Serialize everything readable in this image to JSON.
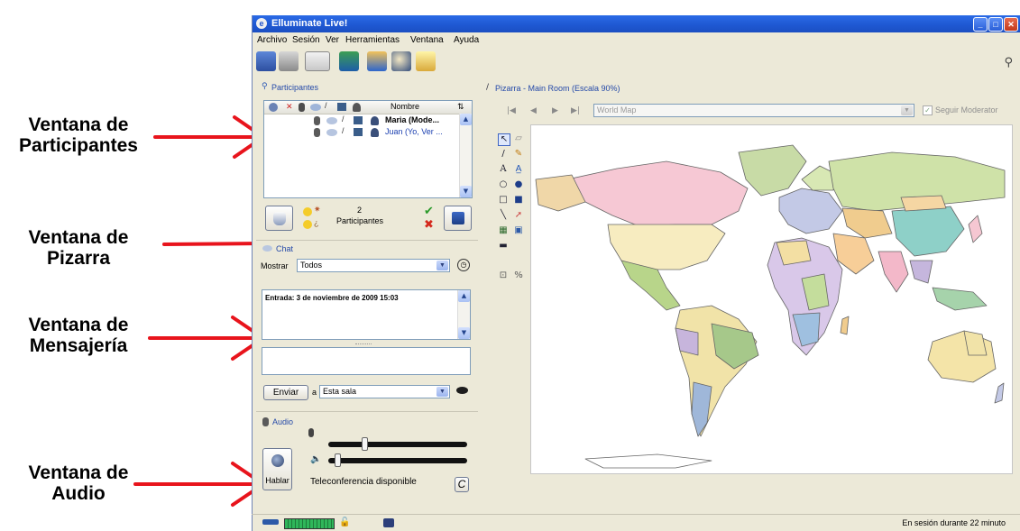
{
  "annotations": {
    "participants": "Ventana de Participantes",
    "whiteboard": "Ventana de Pizarra",
    "chat": "Ventana de Mensajería",
    "audio": "Ventana de Audio"
  },
  "window": {
    "title": "Elluminate Live!",
    "menu": [
      "Archivo",
      "Sesión",
      "Ver",
      "Herramientas",
      "Ventana",
      "Ayuda"
    ]
  },
  "participants": {
    "header": "Participantes",
    "column_name": "Nombre",
    "rows": [
      "Maria (Mode...",
      "Juan (Yo, Ver ..."
    ],
    "count": "2",
    "count_label": "Participantes"
  },
  "chat": {
    "header": "Chat",
    "show_label": "Mostrar",
    "show_value": "Todos",
    "entry": "Entrada: 3 de noviembre de 2009 15:03",
    "send_button": "Enviar",
    "to_label": "a",
    "room_value": "Esta sala"
  },
  "audio": {
    "header": "Audio",
    "talk_button": "Hablar",
    "teleconference": "Teleconferencia disponible",
    "mic_level": 0.25,
    "speaker_level": 0.05
  },
  "whiteboard": {
    "title": "Pizarra - Main Room (Escala 90%)",
    "screen_select": "World Map",
    "follow_moderator": "Seguir Moderator"
  },
  "status": {
    "session_time": "En sesión durante 22 minuto"
  },
  "colors": {
    "title_blue": "#1f58d3",
    "panel_bg": "#ece9d8",
    "header_text": "#2449a8",
    "arrow_red": "#e8141c"
  }
}
